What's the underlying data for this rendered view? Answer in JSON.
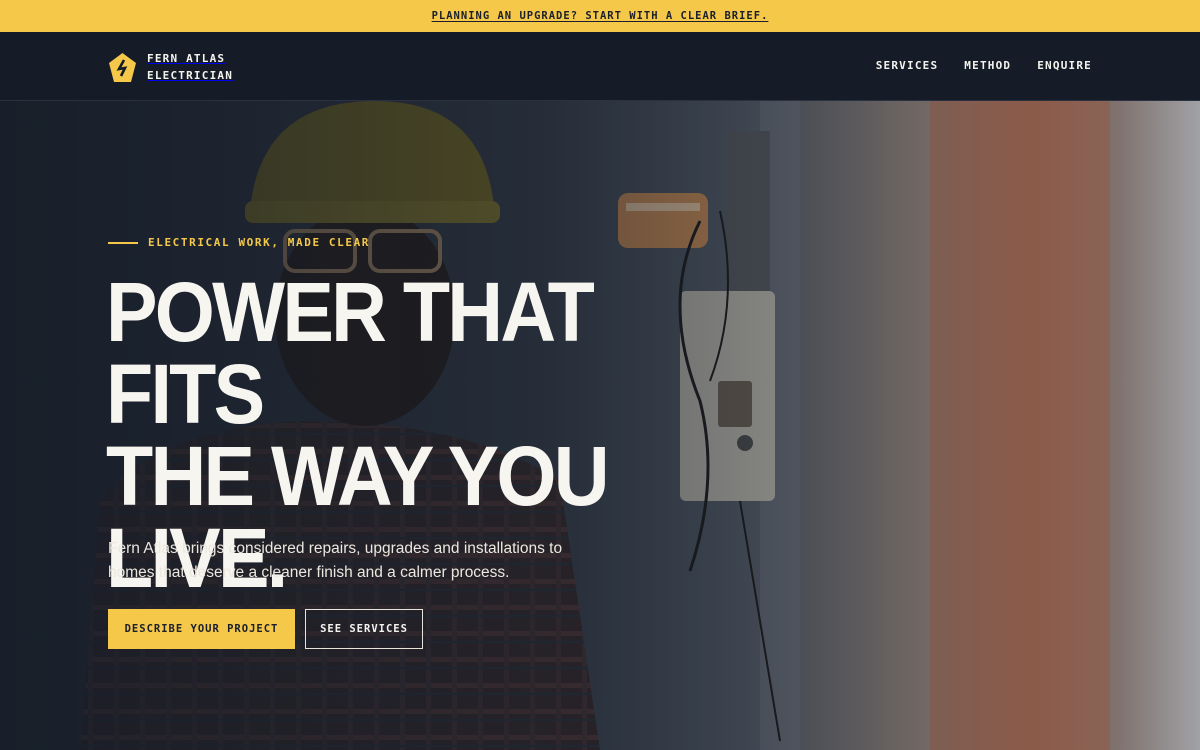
{
  "announcement": {
    "text": "PLANNING AN UPGRADE? START WITH A CLEAR BRIEF."
  },
  "brand": {
    "line1": "FERN ATLAS",
    "line2": "ELECTRICIAN",
    "icon": "lightning-pentagon-icon"
  },
  "nav": {
    "items": [
      "SERVICES",
      "METHOD",
      "ENQUIRE"
    ]
  },
  "hero": {
    "eyebrow": "ELECTRICAL WORK, MADE CLEAR",
    "headline": [
      "POWER THAT FITS",
      "THE WAY YOU",
      "LIVE."
    ],
    "lede": "Fern Atlas brings considered repairs, upgrades and installations to homes that deserve a cleaner finish and a calmer process.",
    "cta_primary": "DESCRIBE YOUR PROJECT",
    "cta_secondary": "SEE SERVICES"
  },
  "colors": {
    "accent": "#f5c84a",
    "dark": "#151b27",
    "text": "#f5f3ee"
  }
}
